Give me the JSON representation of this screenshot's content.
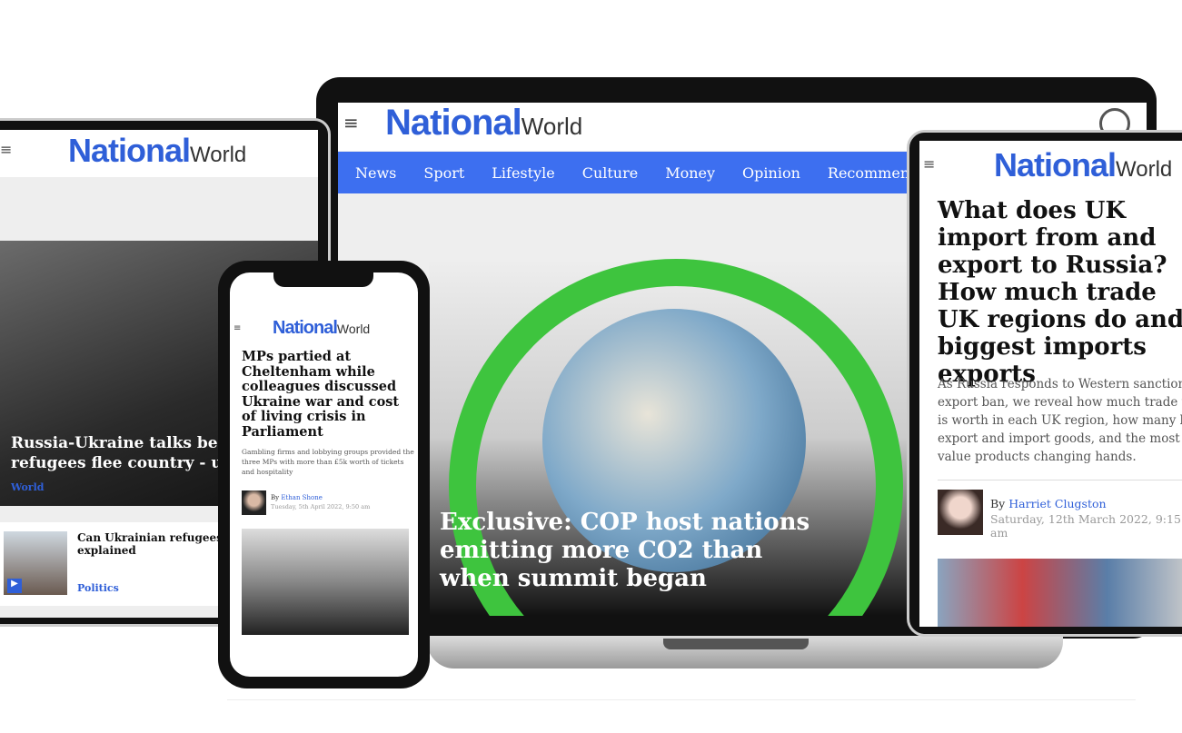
{
  "brand": {
    "logo_main": "National",
    "logo_sub": "World",
    "accent": "#3d6ff0"
  },
  "laptop": {
    "nav": [
      "News",
      "Sport",
      "Lifestyle",
      "Culture",
      "Money",
      "Opinion",
      "Recommended"
    ],
    "hero_headline": "Exclusive: COP host nations emitting more CO2 than when summit began"
  },
  "left_tablet": {
    "hero_headline": "Russia-Ukraine talks begin as refugees flee country - upd",
    "hero_category": "World",
    "item_title": "Can Ukrainian refugees co rules explained",
    "item_category": "Politics"
  },
  "phone": {
    "headline": "MPs partied at Cheltenham while colleagues discussed Ukraine war and cost of living crisis in Parliament",
    "summary": "Gambling firms and lobbying groups provided the three MPs with more than £5k worth of tickets and hospitality",
    "by": "By",
    "author": "Ethan Shone",
    "date": "Tuesday, 5th April 2022, 9:50 am"
  },
  "right_tablet": {
    "headline": "What does UK import from and export to Russia? How much trade UK regions do and biggest imports exports",
    "summary": "As Russia responds to Western sanctions export ban, we reveal how much trade wi is worth in each UK region, how many bu export and import goods, and the most h value products changing hands.",
    "by": "By",
    "author": "Harriet Clugston",
    "date": "Saturday, 12th March 2022, 9:15 am"
  }
}
